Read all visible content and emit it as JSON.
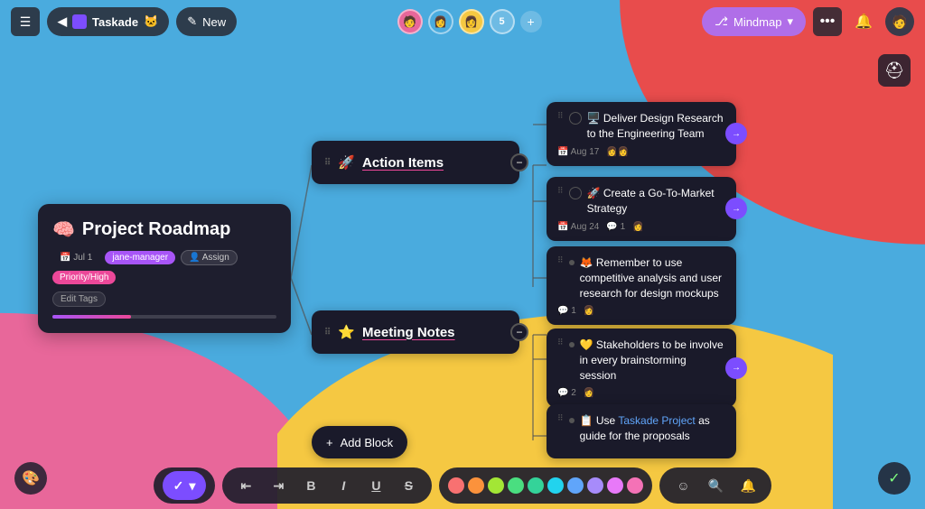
{
  "app": {
    "title": "Taskade",
    "new_label": "New",
    "mindmap_label": "Mindmap"
  },
  "topbar": {
    "menu_icon": "☰",
    "back_icon": "◀",
    "taskade_label": "Taskade",
    "new_icon": "✎",
    "dots_icon": "•••",
    "bell_icon": "🔔",
    "avatar_count": "5",
    "avatar_plus": "+"
  },
  "project_card": {
    "emoji": "🧠",
    "title": "Project Roadmap",
    "date": "Jul 1",
    "tag_manager": "jane-manager",
    "tag_assign": "Assign",
    "tag_priority": "Priority/High",
    "tag_edittags": "Edit Tags"
  },
  "block_action": {
    "drag": "⠿",
    "emoji": "🚀",
    "label": "Action Items",
    "collapse": "−"
  },
  "block_meeting": {
    "drag": "⠿",
    "emoji": "⭐",
    "label": "Meeting Notes",
    "collapse": "−"
  },
  "tasks": [
    {
      "drag": "⠿",
      "emoji": "🖥️",
      "title": "Deliver Design Research to the Engineering Team",
      "date": "Aug 17",
      "comments": "",
      "has_check": true
    },
    {
      "drag": "⠿",
      "emoji": "🚀",
      "title": "Create a Go-To-Market Strategy",
      "date": "Aug 24",
      "comments": "1",
      "has_check": true
    },
    {
      "drag": "⠿",
      "emoji": "🦊",
      "title": "Remember to use competitive analysis and user research for design mockups",
      "comments": "1",
      "has_check": false,
      "is_dot": true
    },
    {
      "drag": "⠿",
      "emoji": "💛",
      "title": "Stakeholders to be involve in every brainstorming session",
      "comments": "2",
      "has_check": false,
      "is_dot": true
    },
    {
      "drag": "⠿",
      "emoji": "📋",
      "title": "Use Taskade Project as guide for the proposals",
      "title_link": "Taskade Project",
      "comments": "",
      "has_check": false,
      "is_dot": true
    }
  ],
  "add_block": {
    "icon": "+",
    "label": "Add Block"
  },
  "toolbar": {
    "check_icon": "✓",
    "indent_out": "⇤",
    "indent_in": "⇥",
    "bold": "B",
    "italic": "I",
    "underline": "U",
    "strikethrough": "S",
    "emoji_icon": "☺",
    "search_icon": "🔍",
    "notify_icon": "🔔",
    "colors": [
      "#f87171",
      "#fb923c",
      "#a3e635",
      "#4ade80",
      "#34d399",
      "#22d3ee",
      "#60a5fa",
      "#a78bfa",
      "#e879f9",
      "#f472b6"
    ]
  },
  "corner": {
    "left_icon": "🎨",
    "right_icon": "✓",
    "helmet_icon": "⛑"
  }
}
